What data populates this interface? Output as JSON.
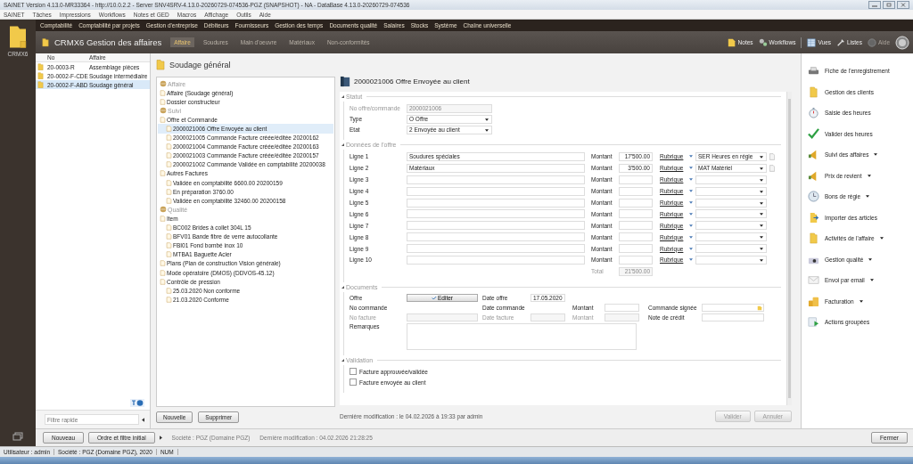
{
  "window": {
    "title": "SAINET Version 4.13.0-MR33364 - http://10.0.2.2 - Server SNV4SRV-4.13.0-20260729-074536-PGZ (SNAPSHOT) - NA - DataBase 4.13.0-20260729-074536"
  },
  "menu": [
    "SAINET",
    "Tâches",
    "Impressions",
    "Workflows",
    "Notes et GED",
    "Macros",
    "Affichage",
    "Outils",
    "Aide"
  ],
  "modules": [
    "Comptabilité",
    "Comptabilité par projets",
    "Gestion d'entreprise",
    "Débiteurs",
    "Fournisseurs",
    "Gestion des temps",
    "Documents qualité",
    "Salaires",
    "Stocks",
    "Système",
    "Chaîne universelle"
  ],
  "app": {
    "logo_label": "CRMX6",
    "title": "CRMX6 Gestion des affaires"
  },
  "subtabs": [
    {
      "label": "Affaire",
      "selected": true
    },
    {
      "label": "Soudures",
      "selected": false
    },
    {
      "label": "Main d'oeuvre",
      "selected": false
    },
    {
      "label": "Matériaux",
      "selected": false
    },
    {
      "label": "Non-conformités",
      "selected": false
    }
  ],
  "toolbar": [
    {
      "label": "Notes",
      "disabled": false
    },
    {
      "label": "Workflows",
      "disabled": false
    },
    {
      "label": "Vues",
      "disabled": false
    },
    {
      "label": "Listes",
      "disabled": false
    },
    {
      "label": "Aide",
      "disabled": true
    }
  ],
  "list": {
    "columns": [
      "No",
      "Affaire"
    ],
    "rows": [
      {
        "no": "20-0003-R",
        "affaire": "Assemblage pièces",
        "selected": false
      },
      {
        "no": "20-0002-F-CDE",
        "affaire": "Soudage intermédiaire",
        "selected": false
      },
      {
        "no": "20-0002-F-ABD",
        "affaire": "Soudage général",
        "selected": true
      }
    ],
    "filter_placeholder": "Filtre rapide",
    "buttons": [
      "Nouveau",
      "Ordre et filtre initial"
    ]
  },
  "tree": {
    "title": "Soudage général",
    "nodes": [
      {
        "kind": "section",
        "label": "Affaire",
        "selected": false,
        "children": [
          {
            "kind": "node",
            "label": "Affaire (Soudage général)",
            "selected": false
          },
          {
            "kind": "node",
            "label": "Dossier constructeur",
            "selected": false
          }
        ]
      },
      {
        "kind": "section",
        "label": "Suivi",
        "selected": false,
        "children": [
          {
            "kind": "node",
            "label": "Offre et Commande",
            "selected": false,
            "children": [
              {
                "kind": "node",
                "label": "2000021006 Offre Envoyée au client",
                "selected": true
              },
              {
                "kind": "node",
                "label": "2000021005 Commande Facture créée/éditée 20200162",
                "selected": false
              },
              {
                "kind": "node",
                "label": "2000021004 Commande Facture créée/éditée 20200163",
                "selected": false
              },
              {
                "kind": "node",
                "label": "2000021003 Commande Facture créée/éditée 20200157",
                "selected": false
              },
              {
                "kind": "node",
                "label": "2000021002 Commande Validée en comptabilité 20200038",
                "selected": false
              }
            ]
          },
          {
            "kind": "node",
            "label": "Autres Factures",
            "selected": false,
            "children": [
              {
                "kind": "node",
                "label": "Validée en comptabilité 6600.00 20200159",
                "selected": false
              },
              {
                "kind": "node",
                "label": "En préparation 3760.00",
                "selected": false
              },
              {
                "kind": "node",
                "label": "Validée en comptabilité 32460.00 20200158",
                "selected": false
              }
            ]
          }
        ]
      },
      {
        "kind": "section",
        "label": "Qualité",
        "selected": false,
        "children": [
          {
            "kind": "node",
            "label": "Item",
            "selected": false,
            "children": [
              {
                "kind": "node",
                "label": "BC002 Brides à collet 304L 15",
                "selected": false
              },
              {
                "kind": "node",
                "label": "BFV01 Bande fibre de verre autocollante",
                "selected": false
              },
              {
                "kind": "node",
                "label": "FBI01 Fond bombé inox 10",
                "selected": false
              },
              {
                "kind": "node",
                "label": "MTBA1 Baguette Acier",
                "selected": false
              }
            ]
          },
          {
            "kind": "node",
            "label": "Plans (Plan de construction Vision générale)",
            "selected": false
          },
          {
            "kind": "node",
            "label": "Mode opératoire (DMOS) (DDVOS-45.12)",
            "selected": false
          },
          {
            "kind": "node",
            "label": "Contrôle de pression",
            "selected": false,
            "children": [
              {
                "kind": "node",
                "label": "25.03.2020 Non conforme",
                "selected": false
              },
              {
                "kind": "node",
                "label": "21.03.2020 Conforme",
                "selected": false
              }
            ]
          }
        ]
      }
    ],
    "buttons": [
      "Nouvelle",
      "Supprimer"
    ]
  },
  "form": {
    "title": "2000021006 Offre Envoyée au client",
    "statut": {
      "title": "Statut",
      "fields": [
        {
          "label": "No offre/commande",
          "value": "2000021006",
          "kind": "field",
          "disabled": true
        },
        {
          "label": "Type",
          "value": "O Offre",
          "kind": "select",
          "disabled": false
        },
        {
          "label": "Etat",
          "value": "2 Envoyée au client",
          "kind": "select",
          "disabled": false
        }
      ]
    },
    "offre": {
      "title": "Données de l'offre",
      "lines": [
        {
          "label": "Ligne 1",
          "text": "Soudures spéciales",
          "montant_label": "Montant",
          "montant": "17'500.00",
          "rubrique": "Rubrique",
          "rubrique_value": "SER Heures en régie"
        },
        {
          "label": "Ligne 2",
          "text": "Matériaux",
          "montant_label": "Montant",
          "montant": "3'500.00",
          "rubrique": "Rubrique",
          "rubrique_value": "MAT Matériel"
        },
        {
          "label": "Ligne 3",
          "montant_label": "Montant",
          "rubrique": "Rubrique"
        },
        {
          "label": "Ligne 4",
          "montant_label": "Montant",
          "rubrique": "Rubrique"
        },
        {
          "label": "Ligne 5",
          "montant_label": "Montant",
          "rubrique": "Rubrique"
        },
        {
          "label": "Ligne 6",
          "montant_label": "Montant",
          "rubrique": "Rubrique"
        },
        {
          "label": "Ligne 7",
          "montant_label": "Montant",
          "rubrique": "Rubrique"
        },
        {
          "label": "Ligne 8",
          "montant_label": "Montant",
          "rubrique": "Rubrique"
        },
        {
          "label": "Ligne 9",
          "montant_label": "Montant",
          "rubrique": "Rubrique"
        },
        {
          "label": "Ligne 10",
          "montant_label": "Montant",
          "rubrique": "Rubrique"
        }
      ],
      "total_label": "Total",
      "total": "21'500.00"
    },
    "documents": {
      "title": "Documents",
      "rows": [
        [
          {
            "label": "Offre",
            "kind": "button",
            "value": "Editer",
            "disabled": false
          },
          {
            "label": "Date offre",
            "kind": "field",
            "value": "17.05.2020",
            "disabled": false
          }
        ],
        [
          {
            "label": "No commande",
            "kind": "blank",
            "disabled": false
          },
          {
            "label": "Date commande",
            "kind": "blank",
            "disabled": false
          },
          {
            "label": "Montant",
            "kind": "field",
            "disabled": false
          },
          {
            "label": "Commande signée",
            "kind": "picker",
            "disabled": false
          }
        ],
        [
          {
            "label": "No facture",
            "kind": "field",
            "disabled": true
          },
          {
            "label": "Date facture",
            "kind": "field",
            "disabled": true
          },
          {
            "label": "Montant",
            "kind": "field",
            "disabled": true
          },
          {
            "label": "Note de crédit",
            "kind": "field",
            "disabled": false
          }
        ]
      ],
      "remarks_label": "Remarques"
    },
    "validation": {
      "title": "Validation",
      "checks": [
        {
          "label": "Facture approuvée/validée",
          "checked": false
        },
        {
          "label": "Facture envoyée au client",
          "checked": false
        }
      ]
    },
    "footer": "Dernière modification : le 04.02.2026 à 19:33 par admin",
    "buttons": [
      {
        "label": "Valider",
        "disabled": true
      },
      {
        "label": "Annuler",
        "disabled": true
      }
    ]
  },
  "sidebar": [
    {
      "label": "Fiche de l'enregistrement",
      "dropdown": false
    },
    {
      "label": "Gestion des clients",
      "dropdown": false
    },
    {
      "label": "Saisie des heures",
      "dropdown": false
    },
    {
      "label": "Valider des heures",
      "dropdown": false
    },
    {
      "label": "Suivi des affaires",
      "dropdown": true
    },
    {
      "label": "Prix de revient",
      "dropdown": true
    },
    {
      "label": "Bons de régie",
      "dropdown": true
    },
    {
      "label": "Importer des articles",
      "dropdown": false
    },
    {
      "label": "Activités de l'affaire",
      "dropdown": true
    },
    {
      "label": "Gestion qualité",
      "dropdown": true
    },
    {
      "label": "Envoi par email",
      "dropdown": true
    },
    {
      "label": "Facturation",
      "dropdown": true
    },
    {
      "label": "Actions groupées",
      "dropdown": false
    }
  ],
  "bottom_bar": {
    "company": "Société : PGZ (Domaine PGZ)",
    "last_modified": "Dernière modification : 04.02.2026 21:28:25",
    "close": "Fermer"
  },
  "status_bar": [
    "Utilisateur : admin",
    "Société : PGZ (Domaine PGZ), 2020",
    "NUM"
  ]
}
